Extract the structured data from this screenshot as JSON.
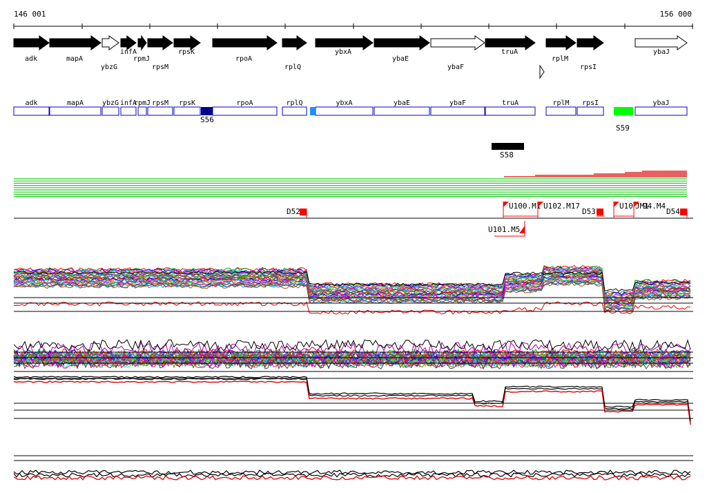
{
  "ruler": {
    "start_label": "146 001",
    "end_label": "156 000"
  },
  "genes": [
    {
      "name": "adk",
      "filled": true
    },
    {
      "name": "mapA",
      "filled": true
    },
    {
      "name": "ybzG",
      "filled": false
    },
    {
      "name": "infA",
      "filled": true
    },
    {
      "name": "rpmJ",
      "filled": true
    },
    {
      "name": "rpsM",
      "filled": true
    },
    {
      "name": "rpsK",
      "filled": true
    },
    {
      "name": "rpoA",
      "filled": true
    },
    {
      "name": "rplQ",
      "filled": true
    },
    {
      "name": "ybxA",
      "filled": true
    },
    {
      "name": "ybaE",
      "filled": true
    },
    {
      "name": "ybaF",
      "filled": false
    },
    {
      "name": "truA",
      "filled": true
    },
    {
      "name": "rplM",
      "filled": true
    },
    {
      "name": "rpsI",
      "filled": true
    },
    {
      "name": "ybaJ",
      "filled": false
    }
  ],
  "gene_boxes": [
    "adk",
    "mapA",
    "ybzG",
    "infA",
    "rpmJ",
    "rpsM",
    "rpsK",
    "rpoA",
    "rplQ",
    "ybxA",
    "ybaE",
    "ybaF",
    "truA",
    "rplM",
    "rpsI",
    "ybaJ"
  ],
  "segments": [
    {
      "label": "S56",
      "color": "#00008b"
    },
    {
      "label": "S59",
      "color": "#00ff00"
    },
    {
      "label": "S58",
      "color": "#000000"
    }
  ],
  "small_marker_color": "#1e90ff",
  "features": [
    {
      "label": "D52"
    },
    {
      "label": "U100.M1"
    },
    {
      "label": "U102.M17"
    },
    {
      "label": "D53"
    },
    {
      "label": "U10"
    },
    {
      "label": "JM1"
    },
    {
      "label": "94.M4"
    },
    {
      "label": "D54"
    },
    {
      "label": "U101.M5"
    }
  ],
  "colors": {
    "feature": "#ff0000",
    "green_lines": "#22cc22",
    "red_lines": "#dd0000",
    "gene_box_border": "#0000cc"
  }
}
